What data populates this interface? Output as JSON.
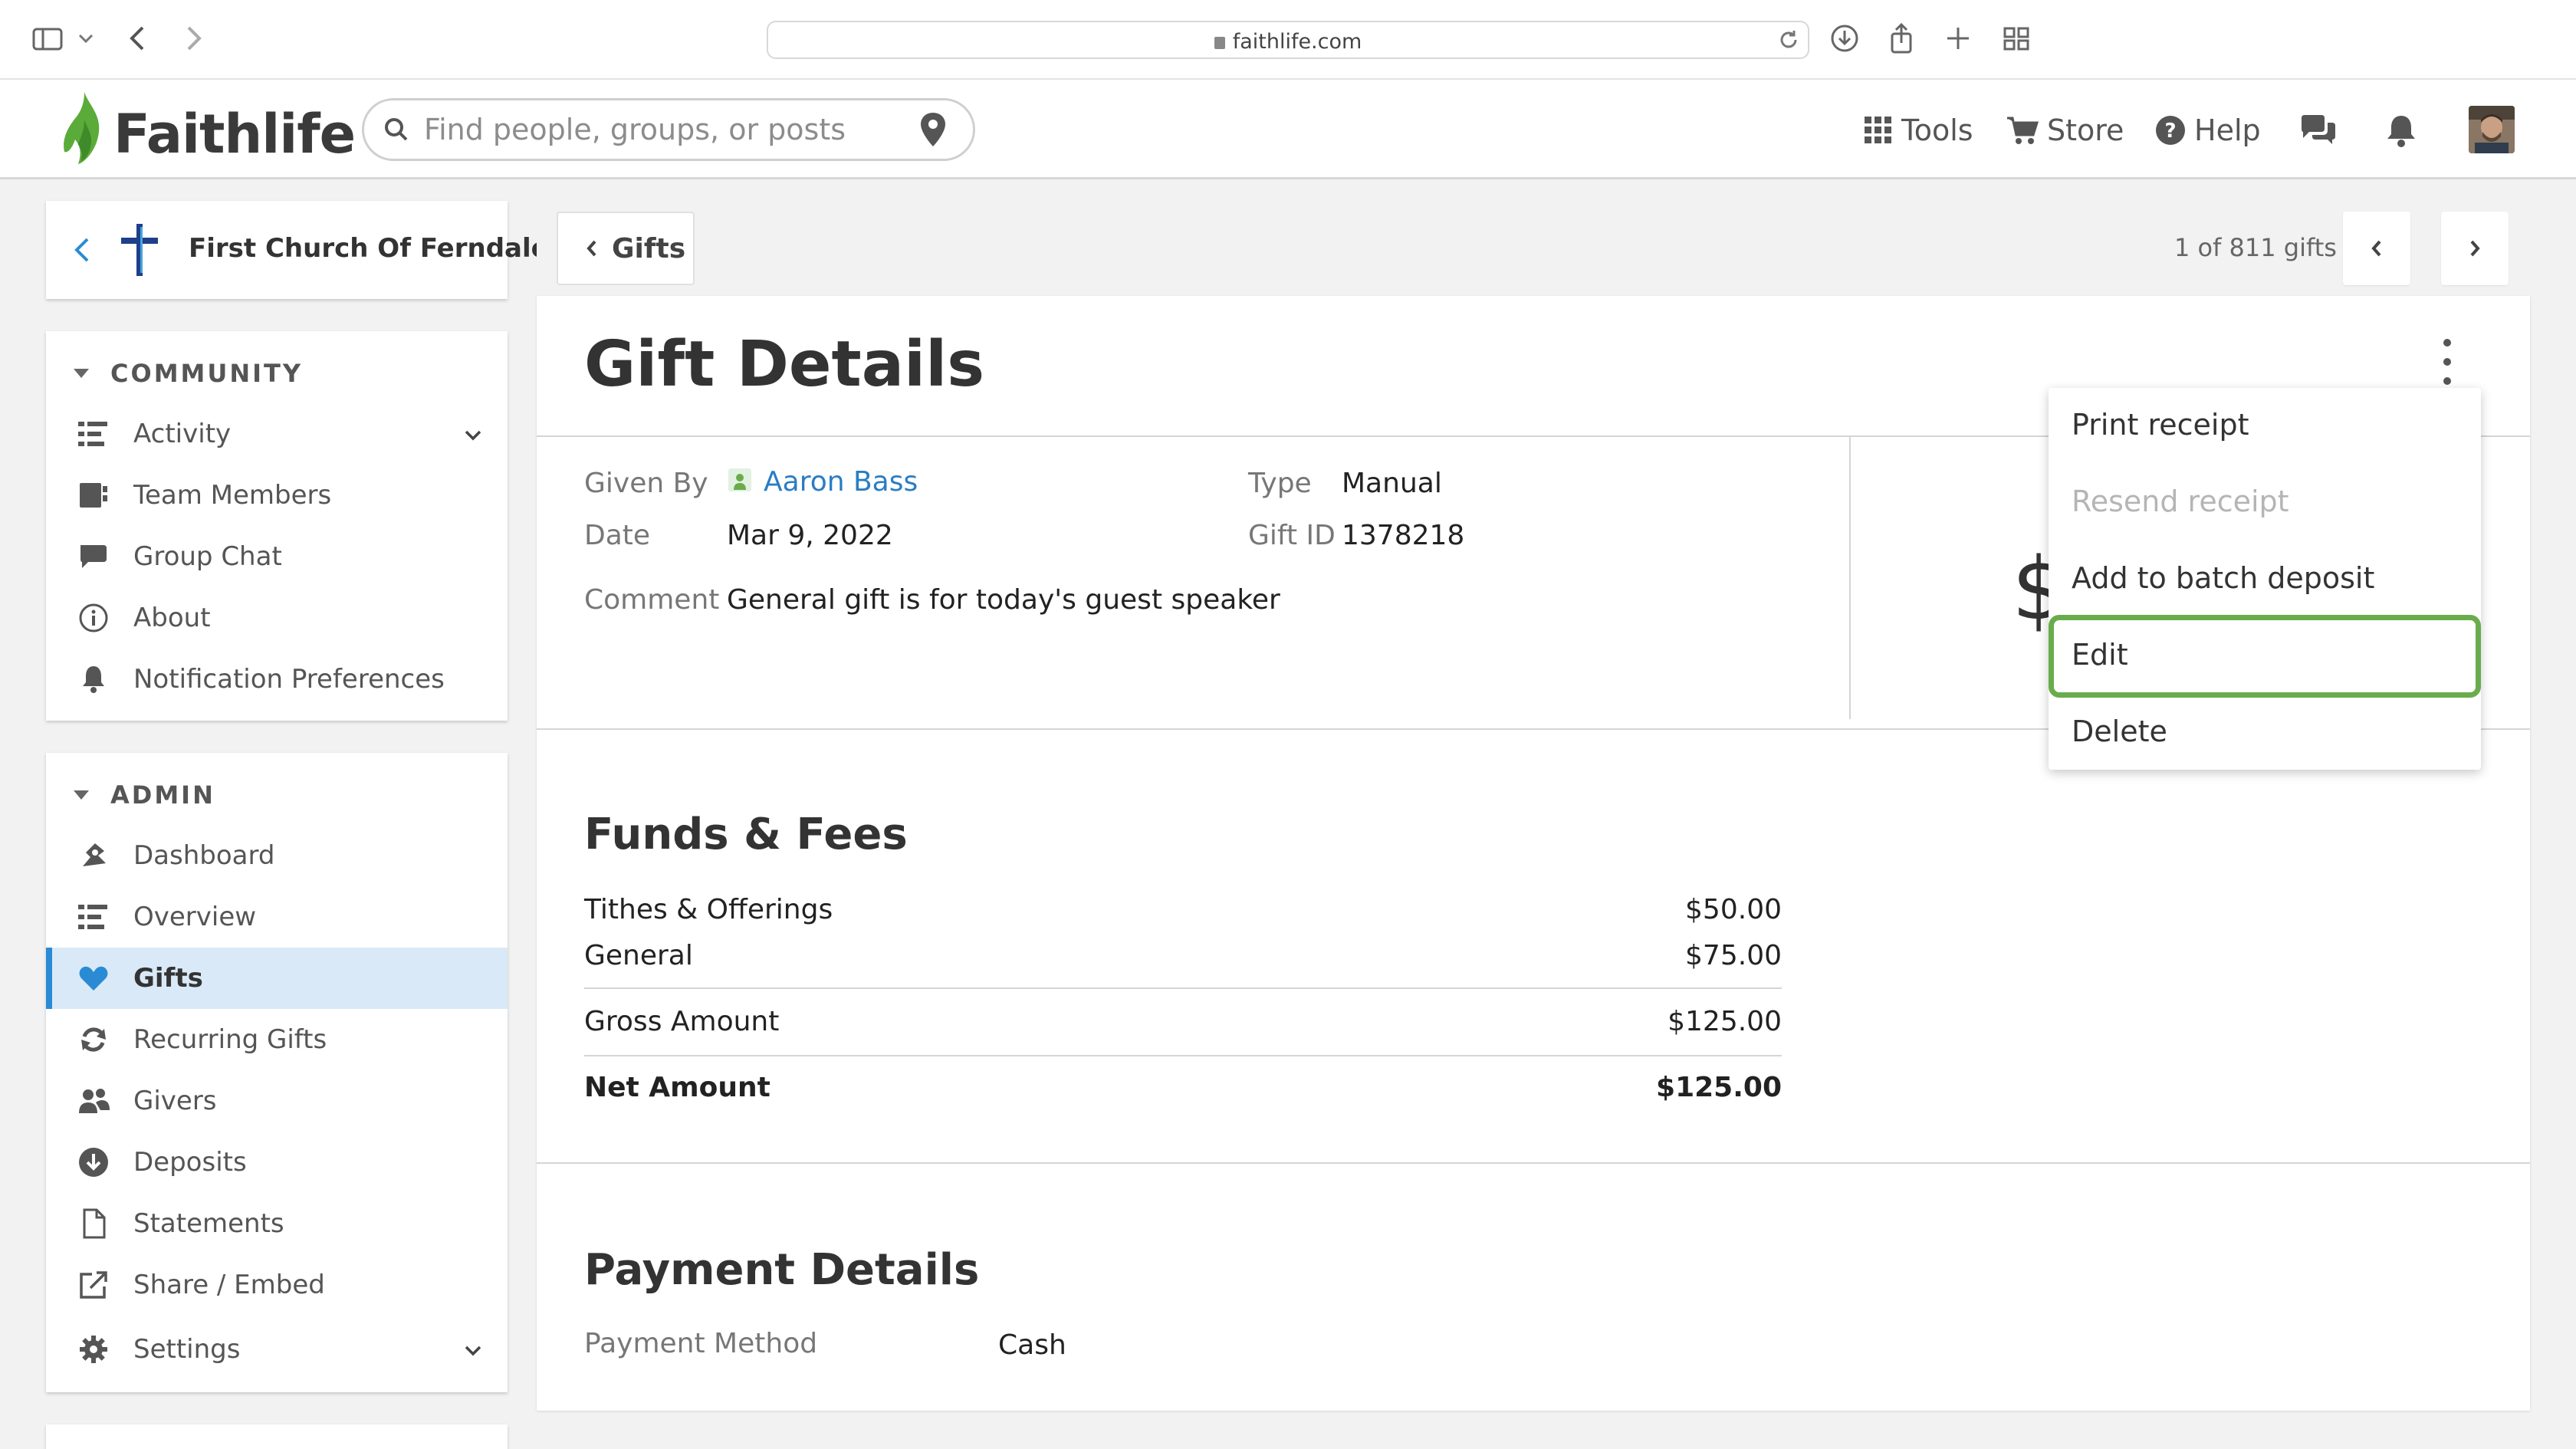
{
  "browser": {
    "url": "faithlife.com",
    "icons": [
      "sidebar-toggle-icon",
      "chevron-down-icon",
      "back-icon",
      "forward-icon",
      "lock-icon",
      "reload-icon",
      "download-icon",
      "share-icon",
      "new-tab-icon",
      "tab-overview-icon"
    ]
  },
  "header": {
    "logo_text": "Faithlife",
    "search_placeholder": "Find people, groups, or posts",
    "nav": {
      "tools": "Tools",
      "store": "Store",
      "help": "Help"
    },
    "icons": [
      "grid-icon",
      "cart-icon",
      "help-icon",
      "chat-icon",
      "bell-icon",
      "location-pin-icon",
      "search-icon"
    ]
  },
  "sidebar": {
    "church_name": "First Church Of Ferndale",
    "community": {
      "heading": "COMMUNITY",
      "items": [
        {
          "label": "Activity",
          "icon": "activity-icon",
          "expandable": true
        },
        {
          "label": "Team Members",
          "icon": "team-members-icon"
        },
        {
          "label": "Group Chat",
          "icon": "chat-bubble-icon"
        },
        {
          "label": "About",
          "icon": "info-icon"
        },
        {
          "label": "Notification Preferences",
          "icon": "bell-icon"
        }
      ]
    },
    "admin": {
      "heading": "ADMIN",
      "items": [
        {
          "label": "Dashboard",
          "icon": "dashboard-icon"
        },
        {
          "label": "Overview",
          "icon": "overview-icon"
        },
        {
          "label": "Gifts",
          "icon": "heart-icon",
          "active": true
        },
        {
          "label": "Recurring Gifts",
          "icon": "recurring-icon"
        },
        {
          "label": "Givers",
          "icon": "givers-icon"
        },
        {
          "label": "Deposits",
          "icon": "deposit-icon"
        },
        {
          "label": "Statements",
          "icon": "document-icon"
        },
        {
          "label": "Share / Embed",
          "icon": "external-link-icon"
        },
        {
          "label": "Settings",
          "icon": "gear-icon",
          "expandable": true
        }
      ]
    }
  },
  "topbar": {
    "back_label": "Gifts",
    "count_text": "1 of 811 gifts"
  },
  "gift": {
    "title": "Gift Details",
    "given_by_label": "Given By",
    "given_by": "Aaron Bass",
    "date_label": "Date",
    "date": "Mar 9, 2022",
    "type_label": "Type",
    "type": "Manual",
    "gift_id_label": "Gift ID",
    "gift_id": "1378218",
    "comment_label": "Comment",
    "comment": "General gift is for today's guest speaker",
    "amount_partial": "$"
  },
  "funds": {
    "heading": "Funds & Fees",
    "rows": [
      {
        "label": "Tithes & Offerings",
        "value": "$50.00"
      },
      {
        "label": "General",
        "value": "$75.00"
      }
    ],
    "gross_label": "Gross Amount",
    "gross_value": "$125.00",
    "net_label": "Net Amount",
    "net_value": "$125.00"
  },
  "payment": {
    "heading": "Payment Details",
    "method_label": "Payment Method",
    "method_value": "Cash"
  },
  "menu": {
    "items": [
      {
        "label": "Print receipt",
        "disabled": false
      },
      {
        "label": "Resend receipt",
        "disabled": true
      },
      {
        "label": "Add to batch deposit",
        "disabled": false
      },
      {
        "label": "Edit",
        "disabled": false,
        "highlighted": true
      },
      {
        "label": "Delete",
        "disabled": false
      }
    ]
  },
  "colors": {
    "accent_blue": "#2a8bd4",
    "active_bg": "#d9e9f7",
    "link_blue": "#2a7dc3",
    "highlight_green": "#6aac4c",
    "logo_green": "#5bab3a"
  }
}
